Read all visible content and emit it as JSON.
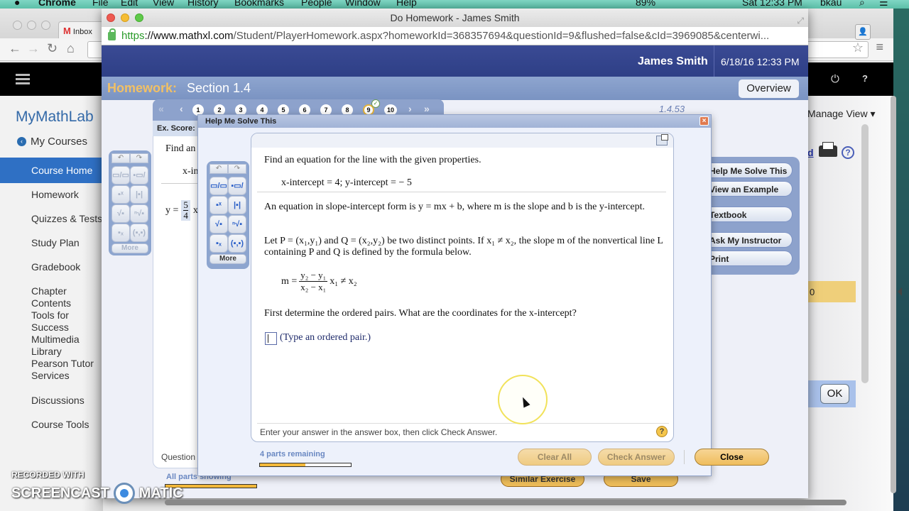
{
  "menubar": {
    "app": "Chrome",
    "items": [
      "File",
      "Edit",
      "View",
      "History",
      "Bookmarks",
      "People",
      "Window",
      "Help"
    ],
    "battery": "89%",
    "clock": "Sat 12:33 PM",
    "user": "bkau"
  },
  "back_browser": {
    "tab_label": "Inbox"
  },
  "window": {
    "title": "Do Homework - James Smith",
    "url_scheme": "https",
    "url_host": "://www.mathxl.com",
    "url_path": "/Student/PlayerHomework.aspx?homeworkId=368357694&questionId=9&flushed=false&cId=3969085&centerwi..."
  },
  "mathxl_header": {
    "user_name": "James Smith",
    "datetime": "6/18/16 12:33 PM",
    "homework_label": "Homework:",
    "section": "Section 1.4",
    "overview_label": "Overview"
  },
  "question_nav": {
    "first": "«",
    "prev": "‹",
    "next": "›",
    "last": "»",
    "numbers": [
      "1",
      "2",
      "3",
      "4",
      "5",
      "6",
      "7",
      "8",
      "9",
      "10"
    ],
    "current": "9",
    "question_id": "1.4.53"
  },
  "mymathlab": {
    "logo": "MyMathLab",
    "my_courses": "My Courses",
    "nav": [
      "Course Home",
      "Homework",
      "Quizzes & Tests",
      "Study Plan",
      "Gradebook",
      "Chapter Contents",
      "Tools for Success",
      "Multimedia Library",
      "Pearson Tutor Services",
      "Discussions",
      "Course Tools"
    ],
    "active": "Course Home",
    "manage_view": "Manage View ▾",
    "print_link": "d",
    "score_band": "0",
    "ok_label": "OK"
  },
  "exercise": {
    "ex_score_label": "Ex. Score:",
    "find_text": "Find an",
    "xint_text": "x-in",
    "answer_prefix": "y =",
    "answer_num": "5",
    "answer_den": "4",
    "answer_suffix": "x",
    "question_label": "Question",
    "all_parts": "All parts showing",
    "similar_label": "Similar Exercise",
    "save_label": "Save"
  },
  "side_tools": [
    "Help Me Solve This",
    "View an Example",
    "Textbook",
    "Ask My Instructor",
    "Print"
  ],
  "palette": {
    "undo": "↶",
    "redo": "↷",
    "buttons": [
      "fraction",
      "mixed-number",
      "exponent",
      "absolute-value",
      "square-root",
      "nth-root",
      "subscript",
      "ordered-pair"
    ],
    "glyphs": [
      "▭/▭",
      "▪▭/▭",
      "▪ˣ",
      "|▪|",
      "√▪",
      "ⁿ√▪",
      "▪ₓ",
      "(▪,▪)"
    ],
    "more_label": "More"
  },
  "dialog": {
    "title": "Help Me Solve This",
    "find": "Find an equation for the line with the given properties.",
    "given": "x-intercept = 4; y-intercept = − 5",
    "p1": "An equation in slope-intercept form is y = mx + b, where m is the slope and b is the y-intercept.",
    "p2_a": "Let P = (x",
    "p2_full": "Let P = (x₁,y₁) and Q = (x₂,y₂) be two distinct points. If x₁ ≠ x₂, the slope m of the nonvertical line L containing P and Q is defined by the formula below.",
    "formula_lhs": "m =",
    "formula_num": "y₂ − y₁",
    "formula_den": "x₂ − x₁",
    "formula_cond": "x₁ ≠ x₂",
    "prompt": "First determine the ordered pairs. What are the coordinates for the x-intercept?",
    "answer_value": "",
    "answer_hint": "(Type an ordered pair.)",
    "footer": "Enter your answer in the answer box, then click Check Answer.",
    "help_glyph": "?",
    "parts_remaining": "4 parts remaining",
    "parts_progress": 0.5,
    "clear_all": "Clear All",
    "check_answer": "Check Answer",
    "close": "Close"
  },
  "watermark": {
    "line1": "RECORDED WITH",
    "line2a": "SCREENCAST",
    "line2b": "MATIC"
  }
}
